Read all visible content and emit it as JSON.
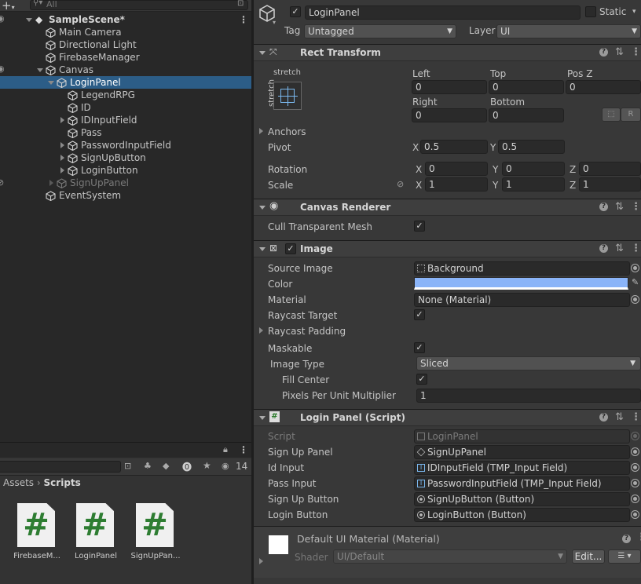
{
  "hierarchy": {
    "search_placeholder": "All",
    "scene": "SampleScene*",
    "items": [
      "Main Camera",
      "Directional Light",
      "FirebaseManager",
      "Canvas",
      "LoginPanel",
      "LegendRPG",
      "ID",
      "IDInputField",
      "Pass",
      "PasswordInputField",
      "SignUpButton",
      "LoginButton",
      "SignUpPanel",
      "EventSystem"
    ]
  },
  "project": {
    "breadcrumb_root": "Assets",
    "breadcrumb_sep": "›",
    "breadcrumb_current": "Scripts",
    "hidden_count": "14",
    "assets": [
      "FirebaseM...",
      "LoginPanel",
      "SignUpPan..."
    ]
  },
  "inspector": {
    "object_name": "LoginPanel",
    "static_label": "Static",
    "tag_label": "Tag",
    "tag_value": "Untagged",
    "layer_label": "Layer",
    "layer_value": "UI",
    "rect": {
      "title": "Rect Transform",
      "anchor_preset_top": "stretch",
      "anchor_preset_side": "stretch",
      "left_label": "Left",
      "left": "0",
      "top_label": "Top",
      "top": "0",
      "posz_label": "Pos Z",
      "posz": "0",
      "right_label": "Right",
      "right": "0",
      "bottom_label": "Bottom",
      "bottom": "0",
      "r_btn": "R",
      "anchors": "Anchors",
      "pivot": "Pivot",
      "pivot_x": "0.5",
      "pivot_y": "0.5",
      "rotation": "Rotation",
      "rot_x": "0",
      "rot_y": "0",
      "rot_z": "0",
      "scale": "Scale",
      "scale_x": "1",
      "scale_y": "1",
      "scale_z": "1",
      "x": "X",
      "y": "Y",
      "z": "Z"
    },
    "canvas_renderer": {
      "title": "Canvas Renderer",
      "cull": "Cull Transparent Mesh"
    },
    "image": {
      "title": "Image",
      "source_label": "Source Image",
      "source": "Background",
      "color_label": "Color",
      "color": "#8ab4f8",
      "material_label": "Material",
      "material": "None (Material)",
      "raycast_target": "Raycast Target",
      "raycast_padding": "Raycast Padding",
      "maskable": "Maskable",
      "image_type_label": "Image Type",
      "image_type": "Sliced",
      "fill_center": "Fill Center",
      "ppu_label": "Pixels Per Unit Multiplier",
      "ppu": "1"
    },
    "script": {
      "title": "Login Panel (Script)",
      "script_label": "Script",
      "script_value": "LoginPanel",
      "fields": [
        {
          "label": "Sign Up Panel",
          "value": "SignUpPanel",
          "icon": "cube"
        },
        {
          "label": "Id Input",
          "value": "IDInputField (TMP_Input Field)",
          "icon": "input"
        },
        {
          "label": "Pass Input",
          "value": "PasswordInputField (TMP_Input Field)",
          "icon": "input"
        },
        {
          "label": "Sign Up Button",
          "value": "SignUpButton (Button)",
          "icon": "button"
        },
        {
          "label": "Login Button",
          "value": "LoginButton (Button)",
          "icon": "button"
        }
      ]
    },
    "material": {
      "title": "Default UI Material (Material)",
      "shader_label": "Shader",
      "shader": "UI/Default",
      "edit": "Edit..."
    }
  }
}
